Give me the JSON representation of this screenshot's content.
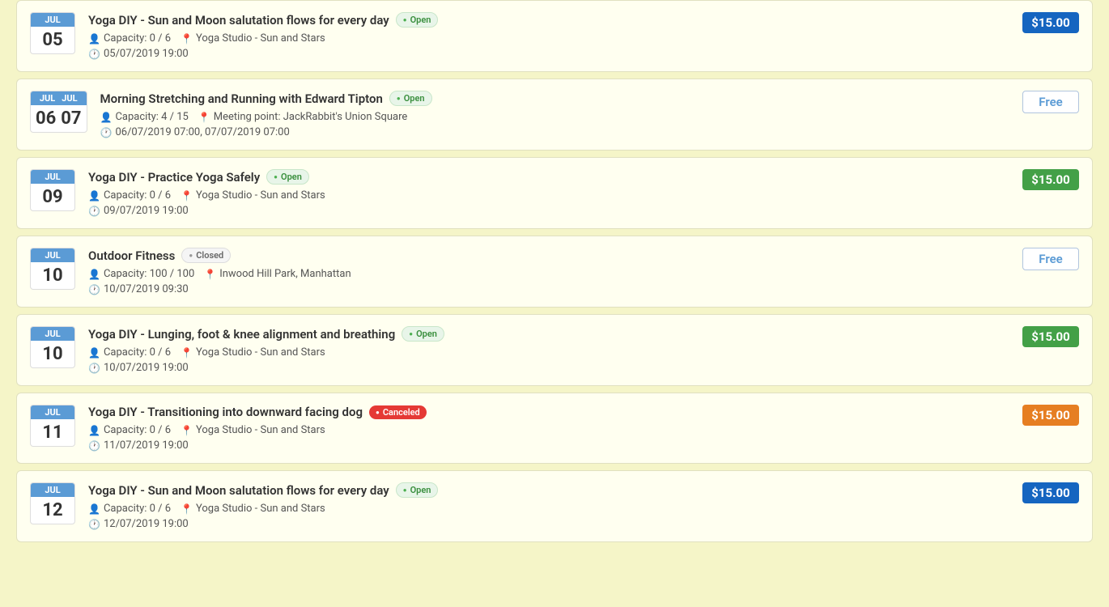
{
  "events": [
    {
      "id": 1,
      "month": "JUL",
      "month2": null,
      "day": "05",
      "day2": null,
      "title": "Yoga DIY - Sun and Moon salutation flows for every day",
      "status": "Open",
      "status_type": "open",
      "capacity": "Capacity: 0 / 6",
      "location": "Yoga Studio - Sun and Stars",
      "datetime": "05/07/2019 19:00",
      "price": "$15.00",
      "price_type": "blue"
    },
    {
      "id": 2,
      "month": "JUL",
      "month2": "JUL",
      "day": "06",
      "day2": "07",
      "title": "Morning Stretching and Running with Edward Tipton",
      "status": "Open",
      "status_type": "open",
      "capacity": "Capacity: 4 / 15",
      "location": "Meeting point: JackRabbit's Union Square",
      "datetime": "06/07/2019 07:00, 07/07/2019 07:00",
      "price": "Free",
      "price_type": "free"
    },
    {
      "id": 3,
      "month": "JUL",
      "month2": null,
      "day": "09",
      "day2": null,
      "title": "Yoga DIY - Practice Yoga Safely",
      "status": "Open",
      "status_type": "open",
      "capacity": "Capacity: 0 / 6",
      "location": "Yoga Studio - Sun and Stars",
      "datetime": "09/07/2019 19:00",
      "price": "$15.00",
      "price_type": "green"
    },
    {
      "id": 4,
      "month": "JUL",
      "month2": null,
      "day": "10",
      "day2": null,
      "title": "Outdoor Fitness",
      "status": "Closed",
      "status_type": "closed",
      "capacity": "Capacity: 100 / 100",
      "location": "Inwood Hill Park, Manhattan",
      "datetime": "10/07/2019 09:30",
      "price": "Free",
      "price_type": "free"
    },
    {
      "id": 5,
      "month": "JUL",
      "month2": null,
      "day": "10",
      "day2": null,
      "title": "Yoga DIY - Lunging, foot & knee alignment and breathing",
      "status": "Open",
      "status_type": "open",
      "capacity": "Capacity: 0 / 6",
      "location": "Yoga Studio - Sun and Stars",
      "datetime": "10/07/2019 19:00",
      "price": "$15.00",
      "price_type": "green"
    },
    {
      "id": 6,
      "month": "JUL",
      "month2": null,
      "day": "11",
      "day2": null,
      "title": "Yoga DIY - Transitioning into downward facing dog",
      "status": "Canceled",
      "status_type": "canceled",
      "capacity": "Capacity: 0 / 6",
      "location": "Yoga Studio - Sun and Stars",
      "datetime": "11/07/2019 19:00",
      "price": "$15.00",
      "price_type": "orange"
    },
    {
      "id": 7,
      "month": "JUL",
      "month2": null,
      "day": "12",
      "day2": null,
      "title": "Yoga DIY - Sun and Moon salutation flows for every day",
      "status": "Open",
      "status_type": "open",
      "capacity": "Capacity: 0 / 6",
      "location": "Yoga Studio - Sun and Stars",
      "datetime": "12/07/2019 19:00",
      "price": "$15.00",
      "price_type": "blue"
    }
  ]
}
